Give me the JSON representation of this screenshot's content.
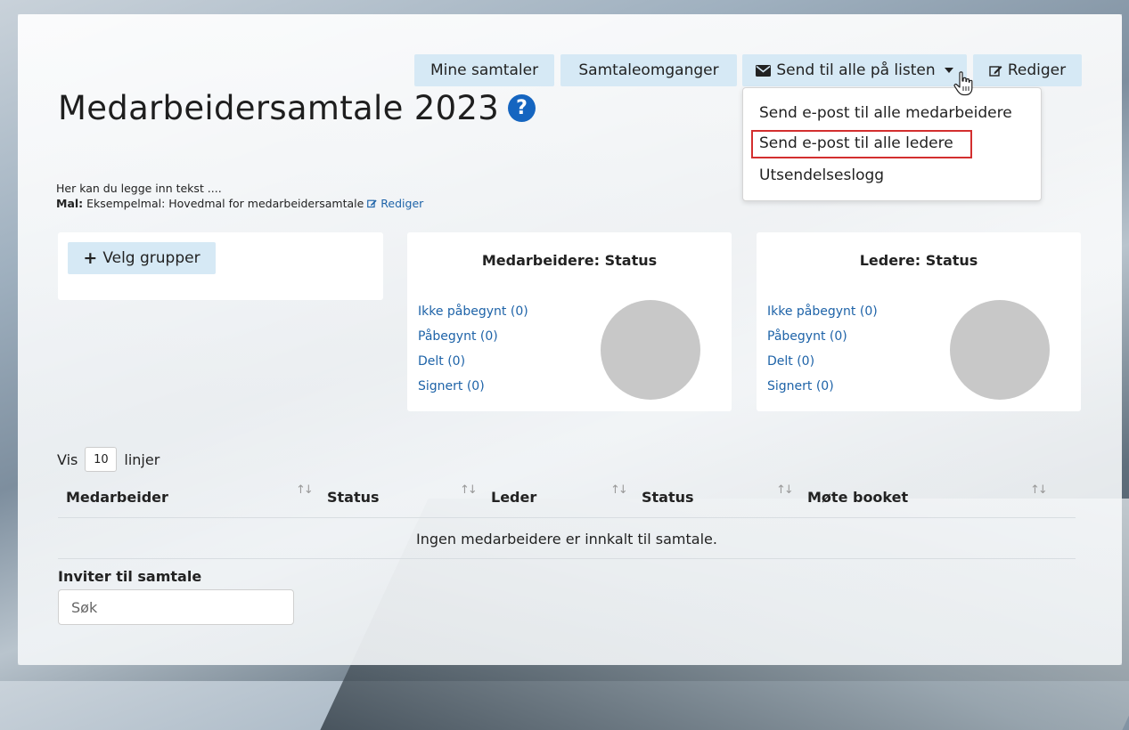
{
  "toolbar": {
    "mine_samtaler": "Mine samtaler",
    "samtaleomganger": "Samtaleomganger",
    "send_til_alle": "Send til alle på listen",
    "rediger": "Rediger"
  },
  "dropdown": {
    "items": [
      "Send e-post til alle medarbeidere",
      "Send e-post til alle ledere",
      "Utsendelseslogg"
    ]
  },
  "page": {
    "title": "Medarbeidersamtale 2023",
    "intro_text": "Her kan du legge inn tekst ....",
    "mal_label": "Mal:",
    "mal_value": "Eksempelmal: Hovedmal for medarbeidersamtale",
    "mal_edit": "Rediger"
  },
  "groups": {
    "velg_grupper": "Velg grupper"
  },
  "medarbeidere_status": {
    "title": "Medarbeidere: Status",
    "items": [
      "Ikke påbegynt (0)",
      "Påbegynt (0)",
      "Delt (0)",
      "Signert (0)"
    ]
  },
  "ledere_status": {
    "title": "Ledere: Status",
    "items": [
      "Ikke påbegynt (0)",
      "Påbegynt (0)",
      "Delt (0)",
      "Signert (0)"
    ]
  },
  "table": {
    "vis": "Vis",
    "lines_value": "10",
    "linjer": "linjer",
    "columns": [
      "Medarbeider",
      "Status",
      "Leder",
      "Status",
      "Møte booket"
    ],
    "empty_text": "Ingen medarbeidere er innkalt til samtale."
  },
  "invite": {
    "label": "Inviter til samtale",
    "search_placeholder": "Søk"
  },
  "colors": {
    "button_bg": "#d6e9f5",
    "link": "#1e63a8",
    "help_icon": "#1565c0",
    "highlight_border": "#d32f2f",
    "pie": "#c8c8c8"
  },
  "icons": [
    "envelope-icon",
    "caret-down-icon",
    "edit-icon",
    "help-icon",
    "plus-icon",
    "sort-icon",
    "hand-cursor-icon"
  ]
}
